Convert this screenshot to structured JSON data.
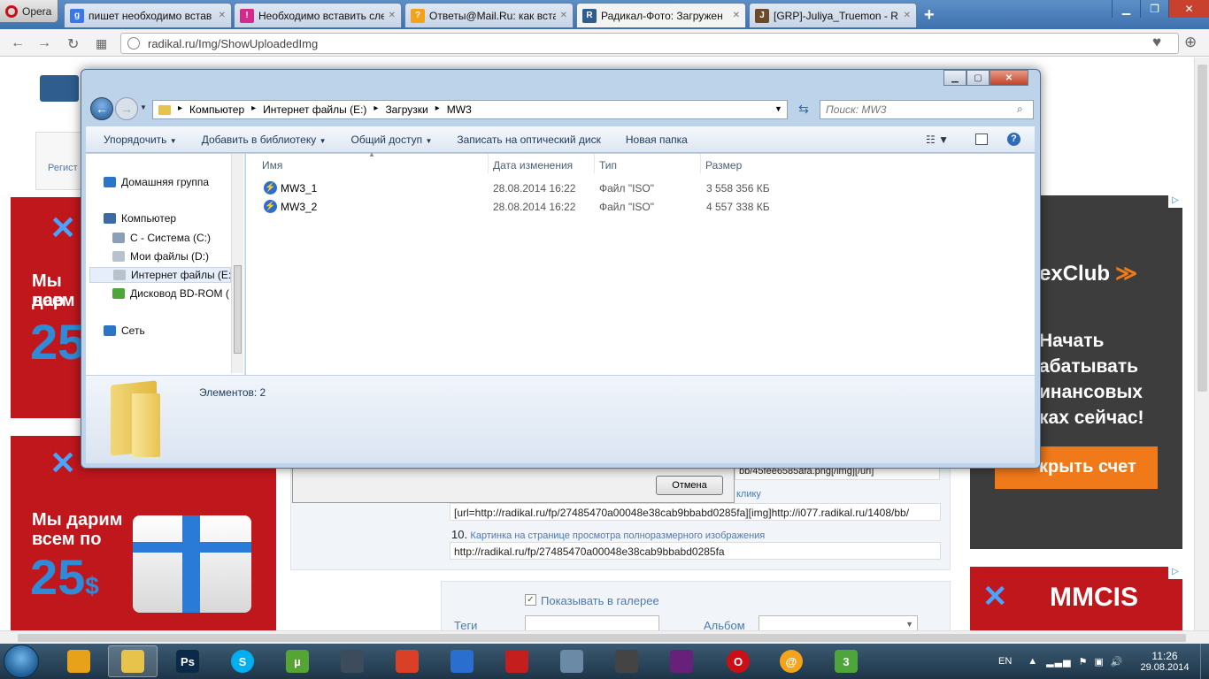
{
  "browser": {
    "menu_label": "Opera",
    "tabs": [
      {
        "title": "пишет необходимо встав",
        "favicon_letter": "g",
        "color": "#3b78e7"
      },
      {
        "title": "Необходимо вставить сле",
        "favicon_letter": "!",
        "color": "#d42a8b"
      },
      {
        "title": "Ответы@Mail.Ru: как вста",
        "favicon_letter": "?",
        "color": "#f4a11c"
      },
      {
        "title": "Радикал-Фото: Загружен",
        "favicon_letter": "R",
        "color": "#2e5d8e"
      },
      {
        "title": "[GRP]-Juliya_Truemon - R",
        "favicon_letter": "J",
        "color": "#6b4a2a"
      }
    ],
    "active_tab": 3,
    "url": "radikal.ru/Img/ShowUploadedImg"
  },
  "page": {
    "left_nav_text": "Регист",
    "ad_top_text_1": "Мы дар",
    "ad_top_text_2": "всем",
    "ad_top_num": "25",
    "ad_bottom_text_1": "Мы дарим",
    "ad_bottom_text_2": "всем по",
    "ad_bottom_num": "25",
    "ad_bottom_cur": "$",
    "mmcis_brand": "MMCIS",
    "forex_brand": "exClub",
    "forex_lines": [
      "Начать",
      "абатывать",
      "инансовых",
      "ках сейчас!"
    ],
    "forex_button": "крыть счет",
    "partial_field_9": "bb/45fee6585afa.png[/img][/url]",
    "cancel_label": "Отмена",
    "partial_label_9": "клику",
    "field_9_value": "[url=http://radikal.ru/fp/27485470a00048e38cab9bbabd0285fa][img]http://i077.radikal.ru/1408/bb/",
    "item_10_num": "10.",
    "item_10_label": "Картинка на странице просмотра полноразмерного изображения",
    "field_10_value": "http://radikal.ru/fp/27485470a00048e38cab9bbabd0285fa",
    "show_in_gallery": "Показывать в галерее",
    "show_in_gallery_checked": true,
    "tags_label": "Теги",
    "album_label": "Альбом"
  },
  "explorer": {
    "breadcrumb": [
      "Компьютер",
      "Интернет файлы (E:)",
      "Загрузки",
      "MW3"
    ],
    "search_placeholder": "Поиск: MW3",
    "toolbar": [
      "Упорядочить",
      "Добавить в библиотеку",
      "Общий доступ",
      "Записать на оптический диск",
      "Новая папка"
    ],
    "nav": [
      {
        "label": "Домашняя группа",
        "indent": false,
        "icon": "homegroup-icon"
      },
      {
        "label": "Компьютер",
        "indent": false,
        "icon": "computer-icon"
      },
      {
        "label": "C - Система (C:)",
        "indent": true,
        "icon": "drive-c-icon"
      },
      {
        "label": "Мои файлы (D:)",
        "indent": true,
        "icon": "drive-icon"
      },
      {
        "label": "Интернет файлы (E:",
        "indent": true,
        "icon": "drive-icon",
        "selected": true
      },
      {
        "label": "Дисковод BD-ROM (",
        "indent": true,
        "icon": "bd-rom-icon"
      },
      {
        "label": "Сеть",
        "indent": false,
        "icon": "network-icon"
      }
    ],
    "columns": [
      "Имя",
      "Дата изменения",
      "Тип",
      "Размер"
    ],
    "files": [
      {
        "name": "MW3_1",
        "date": "28.08.2014 16:22",
        "type": "Файл \"ISO\"",
        "size": "3 558 356 КБ"
      },
      {
        "name": "MW3_2",
        "date": "28.08.2014 16:22",
        "type": "Файл \"ISO\"",
        "size": "4 557 338 КБ"
      }
    ],
    "status": "Элементов: 2"
  },
  "taskbar": {
    "apps": [
      {
        "name": "daemon-tools-icon",
        "label": "",
        "color": "#e8a21a"
      },
      {
        "name": "explorer-icon",
        "label": "",
        "color": "#e8c34c"
      },
      {
        "name": "photoshop-icon",
        "label": "Ps",
        "color": "#0b2a4a"
      },
      {
        "name": "skype-icon",
        "label": "S",
        "color": "#00aff0"
      },
      {
        "name": "utorrent-icon",
        "label": "µ",
        "color": "#56a434"
      },
      {
        "name": "steam-icon",
        "label": "",
        "color": "#3d4c5c"
      },
      {
        "name": "ccleaner-icon",
        "label": "",
        "color": "#d94026"
      },
      {
        "name": "daemon-lightning-icon",
        "label": "",
        "color": "#2a6ecf"
      },
      {
        "name": "antivirus-icon",
        "label": "",
        "color": "#c41e1e"
      },
      {
        "name": "media-player-icon",
        "label": "",
        "color": "#6a8aa6"
      },
      {
        "name": "steelseries-icon",
        "label": "",
        "color": "#444"
      },
      {
        "name": "visual-studio-icon",
        "label": "",
        "color": "#68217a"
      },
      {
        "name": "opera-task-icon",
        "label": "O",
        "color": "#cc0f16"
      },
      {
        "name": "mail-agent-icon",
        "label": "@",
        "color": "#f5a31a"
      },
      {
        "name": "game-icon",
        "label": "3",
        "color": "#4ea53a"
      }
    ],
    "lang": "EN",
    "time": "11:26",
    "date": "29.08.2014"
  }
}
